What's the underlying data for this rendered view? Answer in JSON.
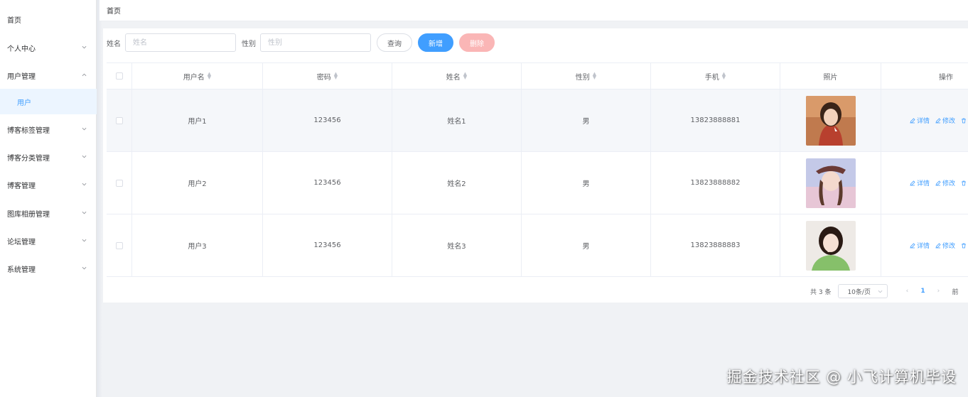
{
  "breadcrumb": "首页",
  "sidebar": {
    "items": [
      {
        "label": "首页",
        "expandable": false
      },
      {
        "label": "个人中心",
        "expandable": true
      },
      {
        "label": "用户管理",
        "expandable": true,
        "expanded": true
      },
      {
        "label": "用户",
        "sub": true,
        "active": true
      },
      {
        "label": "博客标签管理",
        "expandable": true
      },
      {
        "label": "博客分类管理",
        "expandable": true
      },
      {
        "label": "博客管理",
        "expandable": true
      },
      {
        "label": "图库相册管理",
        "expandable": true
      },
      {
        "label": "论坛管理",
        "expandable": true
      },
      {
        "label": "系统管理",
        "expandable": true
      }
    ]
  },
  "search": {
    "name_label": "姓名",
    "name_placeholder": "姓名",
    "gender_label": "性别",
    "gender_placeholder": "性别",
    "query_button": "查询",
    "add_button": "新增",
    "delete_button": "删除"
  },
  "table": {
    "headers": [
      "用户名",
      "密码",
      "姓名",
      "性别",
      "手机",
      "照片",
      "操作"
    ],
    "rows": [
      {
        "username": "用户1",
        "password": "123456",
        "name": "姓名1",
        "gender": "男",
        "phone": "13823888881"
      },
      {
        "username": "用户2",
        "password": "123456",
        "name": "姓名2",
        "gender": "男",
        "phone": "13823888882"
      },
      {
        "username": "用户3",
        "password": "123456",
        "name": "姓名3",
        "gender": "男",
        "phone": "13823888883"
      }
    ],
    "ops": {
      "detail": "详情",
      "edit": "修改"
    }
  },
  "pager": {
    "total": "共 3 条",
    "page_size": "10条/页",
    "current": "1",
    "goto": "前"
  },
  "watermark": "掘金技术社区 @ 小飞计算机毕设",
  "colors": {
    "primary": "#409eff",
    "danger_light": "#fab6b6",
    "active_bg": "#ecf5ff"
  }
}
